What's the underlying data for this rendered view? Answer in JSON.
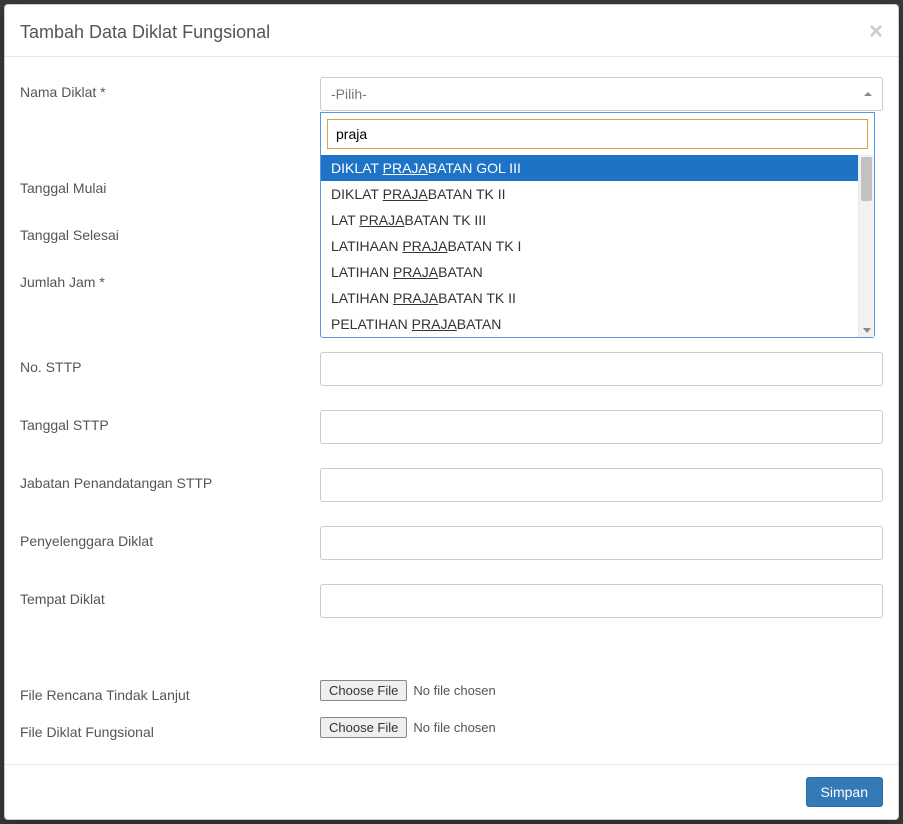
{
  "modal": {
    "title": "Tambah Data Diklat Fungsional"
  },
  "labels": {
    "nama_diklat": "Nama Diklat *",
    "tanggal_mulai": "Tanggal Mulai",
    "tanggal_selesai": "Tanggal Selesai",
    "jumlah_jam": "Jumlah Jam *",
    "no_sttp": "No. STTP",
    "tanggal_sttp": "Tanggal STTP",
    "jabatan_sttp": "Jabatan Penandatangan STTP",
    "penyelenggara": "Penyelenggara Diklat",
    "tempat": "Tempat Diklat",
    "file_rtl": "File Rencana Tindak Lanjut",
    "file_diklat": "File Diklat Fungsional"
  },
  "select": {
    "placeholder": "-Pilih-",
    "search_value": "praja",
    "options": [
      {
        "pre": "DIKLAT ",
        "match": "PRAJA",
        "post": "BATAN GOL III",
        "hl": true
      },
      {
        "pre": "DIKLAT ",
        "match": "PRAJA",
        "post": "BATAN TK II",
        "hl": false
      },
      {
        "pre": "LAT ",
        "match": "PRAJA",
        "post": "BATAN TK III",
        "hl": false
      },
      {
        "pre": "LATIHAAN ",
        "match": "PRAJA",
        "post": "BATAN TK I",
        "hl": false
      },
      {
        "pre": "LATIHAN ",
        "match": "PRAJA",
        "post": "BATAN",
        "hl": false
      },
      {
        "pre": "LATIHAN ",
        "match": "PRAJA",
        "post": "BATAN TK II",
        "hl": false
      },
      {
        "pre": "PELATIHAN ",
        "match": "PRAJA",
        "post": "BATAN",
        "hl": false
      }
    ]
  },
  "file": {
    "button": "Choose File",
    "no_file": "No file chosen"
  },
  "buttons": {
    "save": "Simpan"
  }
}
